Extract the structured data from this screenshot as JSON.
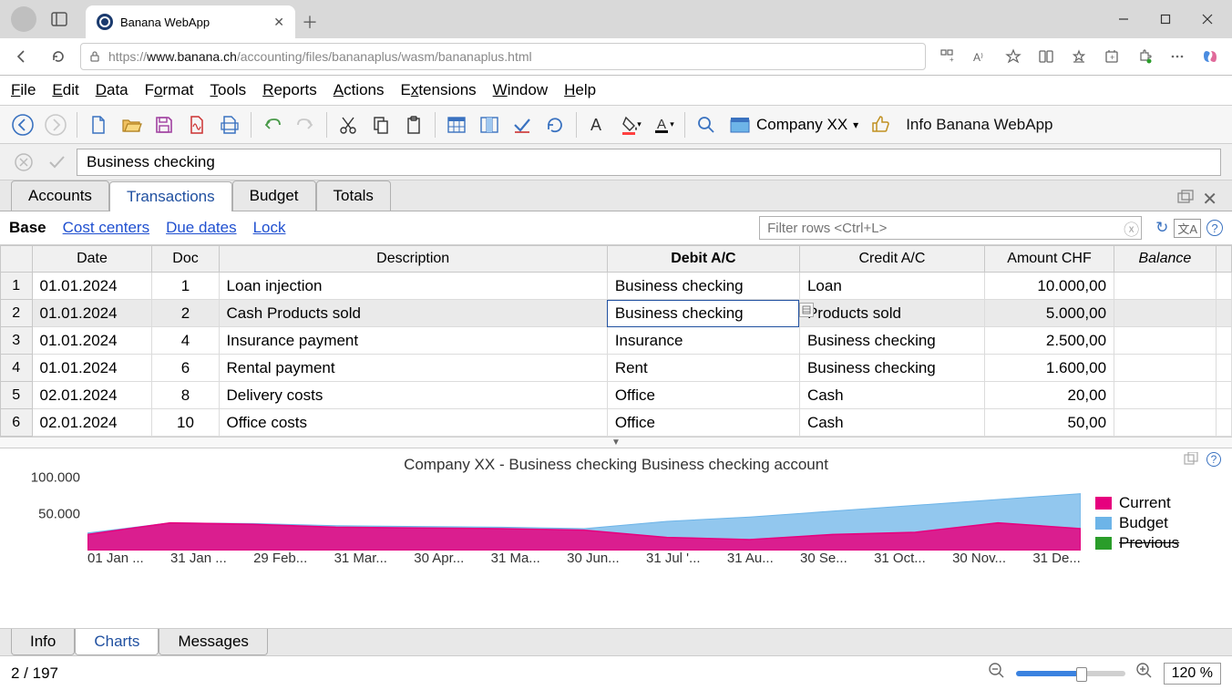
{
  "browser": {
    "tab_title": "Banana WebApp",
    "url_protocol": "https://",
    "url_domain": "www.banana.ch",
    "url_path": "/accounting/files/bananaplus/wasm/bananaplus.html"
  },
  "menubar": [
    "File",
    "Edit",
    "Data",
    "Format",
    "Tools",
    "Reports",
    "Actions",
    "Extensions",
    "Window",
    "Help"
  ],
  "toolbar": {
    "company_label": "Company XX",
    "info_label": "Info Banana WebApp"
  },
  "formula_bar": {
    "value": "Business checking"
  },
  "sheet_tabs": [
    "Accounts",
    "Transactions",
    "Budget",
    "Totals"
  ],
  "active_sheet_tab": 1,
  "sub_links": {
    "base": "Base",
    "links": [
      "Cost centers",
      "Due dates",
      "Lock"
    ],
    "filter_placeholder": "Filter rows <Ctrl+L>"
  },
  "table": {
    "columns": [
      "Date",
      "Doc",
      "Description",
      "Debit A/C",
      "Credit A/C",
      "Amount CHF",
      "Balance"
    ],
    "rows": [
      {
        "n": "1",
        "date": "01.01.2024",
        "doc": "1",
        "desc": "Loan injection",
        "debit": "Business checking",
        "credit": "Loan",
        "amount": "10.000,00",
        "balance": ""
      },
      {
        "n": "2",
        "date": "01.01.2024",
        "doc": "2",
        "desc": "Cash Products sold",
        "debit": "Business checking",
        "credit": "Products sold",
        "amount": "5.000,00",
        "balance": ""
      },
      {
        "n": "3",
        "date": "01.01.2024",
        "doc": "4",
        "desc": "Insurance payment",
        "debit": "Insurance",
        "credit": "Business checking",
        "amount": "2.500,00",
        "balance": ""
      },
      {
        "n": "4",
        "date": "01.01.2024",
        "doc": "6",
        "desc": "Rental payment",
        "debit": "Rent",
        "credit": "Business checking",
        "amount": "1.600,00",
        "balance": ""
      },
      {
        "n": "5",
        "date": "02.01.2024",
        "doc": "8",
        "desc": "Delivery costs",
        "debit": "Office",
        "credit": "Cash",
        "amount": "20,00",
        "balance": ""
      },
      {
        "n": "6",
        "date": "02.01.2024",
        "doc": "10",
        "desc": "Office costs",
        "debit": "Office",
        "credit": "Cash",
        "amount": "50,00",
        "balance": ""
      }
    ],
    "selected_row": 1,
    "active_cell": {
      "row": 1,
      "col": "debit"
    }
  },
  "chart": {
    "title": "Company XX - Business checking Business checking account",
    "legend": [
      {
        "label": "Current",
        "color": "#e6007e"
      },
      {
        "label": "Budget",
        "color": "#6db4e8"
      },
      {
        "label": "Previous",
        "color": "#2a9d2a",
        "strike": true
      }
    ]
  },
  "chart_data": {
    "type": "area",
    "title": "Company XX - Business checking Business checking account",
    "xlabel": "",
    "ylabel": "",
    "ylim": [
      0,
      100000
    ],
    "y_ticks": [
      50000,
      100000
    ],
    "y_tick_labels": [
      "50.000",
      "100.000"
    ],
    "x_tick_labels": [
      "01 Jan ...",
      "31 Jan ...",
      "29 Feb...",
      "31 Mar...",
      "30 Apr...",
      "31 Ma...",
      "30 Jun...",
      "31 Jul '...",
      "31 Au...",
      "30 Se...",
      "31 Oct...",
      "30 Nov...",
      "31 De..."
    ],
    "series": [
      {
        "name": "Current",
        "color": "#e6007e",
        "values": [
          22000,
          38000,
          36000,
          32000,
          31000,
          30000,
          28000,
          18000,
          15000,
          22000,
          25000,
          38000,
          30000
        ]
      },
      {
        "name": "Budget",
        "color": "#6db4e8",
        "values": [
          24000,
          38000,
          37000,
          34000,
          33000,
          32000,
          30000,
          40000,
          46000,
          54000,
          62000,
          70000,
          78000
        ]
      }
    ]
  },
  "bottom_tabs": [
    "Info",
    "Charts",
    "Messages"
  ],
  "active_bottom_tab": 1,
  "statusbar": {
    "position": "2 / 197",
    "zoom": "120 %"
  }
}
